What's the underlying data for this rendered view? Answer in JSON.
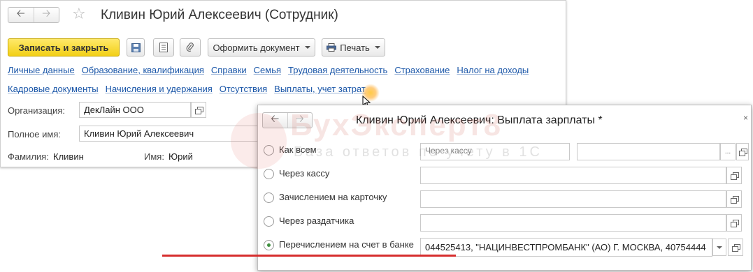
{
  "main_window": {
    "title": "Кливин Юрий Алексеевич (Сотрудник)",
    "toolbar": {
      "save_close": "Записать и закрыть",
      "create_document": "Оформить документ",
      "print": "Печать"
    },
    "links_row1": [
      "Личные данные",
      "Образование, квалификация",
      "Справки",
      "Семья",
      "Трудовая деятельность",
      "Страхование",
      "Налог на доходы"
    ],
    "links_row2": [
      "Кадровые документы",
      "Начисления и удержания",
      "Отсутствия",
      "Выплаты, учет затрат"
    ],
    "org_label": "Организация:",
    "org_value": "ДекЛайн ООО",
    "fullname_label": "Полное имя:",
    "fullname_value": "Кливин Юрий Алексеевич",
    "surname_label": "Фамилия:",
    "surname_value": "Кливин",
    "name_label": "Имя:",
    "name_value": "Юрий"
  },
  "watermark": {
    "title": "БухЭксперт8",
    "subtitle": "База ответов по учету в 1С"
  },
  "dialog": {
    "title": "Кливин Юрий Алексеевич: Выплата зарплаты *",
    "close": "×",
    "options": [
      {
        "label": "Как всем",
        "selected": false,
        "value": "Через кассу",
        "value2": ""
      },
      {
        "label": "Через кассу",
        "selected": false,
        "value": ""
      },
      {
        "label": "Зачислением на карточку",
        "selected": false,
        "value": ""
      },
      {
        "label": "Через раздатчика",
        "selected": false,
        "value": ""
      },
      {
        "label": "Перечислением на счет в банке",
        "selected": true,
        "value": "044525413, \"НАЦИНВЕСТПРОМБАНК\" (АО) Г. МОСКВА, 40754444"
      }
    ],
    "highlight_color": "#d62d2d"
  }
}
